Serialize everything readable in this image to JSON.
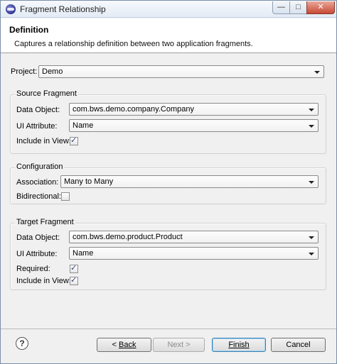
{
  "window": {
    "title": "Fragment Relationship",
    "minimize_glyph": "—",
    "maximize_glyph": "□",
    "close_glyph": "✕"
  },
  "header": {
    "title": "Definition",
    "description": "Captures a relationship definition between two application fragments."
  },
  "project": {
    "label": "Project:",
    "value": "Demo"
  },
  "source_fragment": {
    "title": "Source Fragment",
    "data_object_label": "Data Object:",
    "data_object_value": "com.bws.demo.company.Company",
    "ui_attribute_label": "UI Attribute:",
    "ui_attribute_value": "Name",
    "include_in_view_label": "Include in View:",
    "include_in_view_checked": true
  },
  "configuration": {
    "title": "Configuration",
    "association_label": "Association:",
    "association_value": "Many to Many",
    "bidirectional_label": "Bidirectional:",
    "bidirectional_checked": false
  },
  "target_fragment": {
    "title": "Target Fragment",
    "data_object_label": "Data Object:",
    "data_object_value": "com.bws.demo.product.Product",
    "ui_attribute_label": "UI Attribute:",
    "ui_attribute_value": "Name",
    "required_label": "Required:",
    "required_checked": true,
    "include_in_view_label": "Include in View:",
    "include_in_view_checked": true
  },
  "buttons": {
    "help_glyph": "?",
    "back_prefix": "< ",
    "back_label": "Back",
    "next_label": "Next >",
    "finish_label": "Finish",
    "cancel_label": "Cancel"
  },
  "check_glyph": "✓"
}
